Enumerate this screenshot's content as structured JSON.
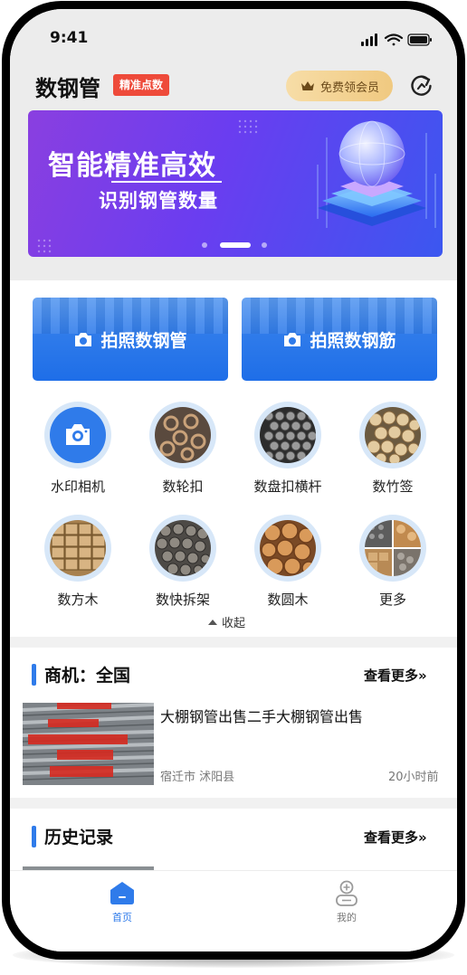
{
  "status_bar": {
    "time": "9:41"
  },
  "header": {
    "title": "数钢管",
    "badge": "精准点数",
    "vip_label": "免费领会员"
  },
  "banner": {
    "headline": "智能精准高效",
    "subline": "识别钢管数量"
  },
  "cards": [
    {
      "label": "拍照数钢管"
    },
    {
      "label": "拍照数钢筋"
    }
  ],
  "tools": [
    {
      "label": "水印相机",
      "icon": "camera-icon"
    },
    {
      "label": "数轮扣",
      "icon": "wheel-buckle-photo"
    },
    {
      "label": "数盘扣横杆",
      "icon": "disk-buckle-photo"
    },
    {
      "label": "数竹签",
      "icon": "bamboo-stick-photo"
    },
    {
      "label": "数方木",
      "icon": "square-timber-photo"
    },
    {
      "label": "数快拆架",
      "icon": "quick-frame-photo"
    },
    {
      "label": "数圆木",
      "icon": "round-log-photo"
    },
    {
      "label": "更多",
      "icon": "more-photo"
    }
  ],
  "collapse_label": "收起",
  "business": {
    "title": "商机：全国",
    "more": "查看更多»",
    "item": {
      "title": "大棚钢管出售二手大棚钢管出售",
      "location": "宿迁市 沭阳县",
      "time": "20小时前"
    }
  },
  "history": {
    "title": "历史记录",
    "more": "查看更多»"
  },
  "tabbar": [
    {
      "label": "首页",
      "active": true,
      "color": "#2f7bea"
    },
    {
      "label": "我的",
      "active": false,
      "color": "#777777"
    }
  ],
  "colors": {
    "accent": "#2f7bea",
    "badge": "#ee4a3a",
    "vip_gold": "#f0c980"
  }
}
